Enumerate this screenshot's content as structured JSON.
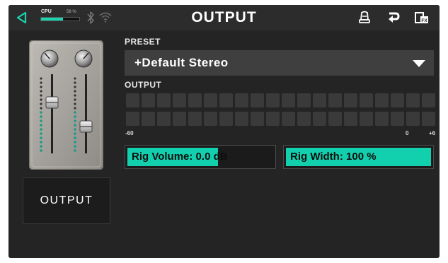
{
  "topbar": {
    "title": "OUTPUT",
    "cpu_label": "CPU",
    "cpu_percent_text": "58 %",
    "cpu_percent": 58,
    "accent": "#1bd4b0",
    "icons": [
      "back-arrow-icon",
      "bluetooth-icon",
      "wifi-icon",
      "tuner-icon",
      "undo-icon",
      "fx-list-icon"
    ]
  },
  "left": {
    "output_button_label": "OUTPUT"
  },
  "preset": {
    "label": "PRESET",
    "value": "+Default Stereo"
  },
  "output_meter": {
    "label": "OUTPUT",
    "segments_per_row": 20,
    "rows": 2,
    "ticks": [
      "-60",
      "0",
      "+6"
    ]
  },
  "rig_volume": {
    "label": "Rig Volume: 0.0 dB",
    "fill_fraction": 0.62
  },
  "rig_width": {
    "label": "Rig Width: 100 %",
    "fill_fraction": 1.0
  }
}
